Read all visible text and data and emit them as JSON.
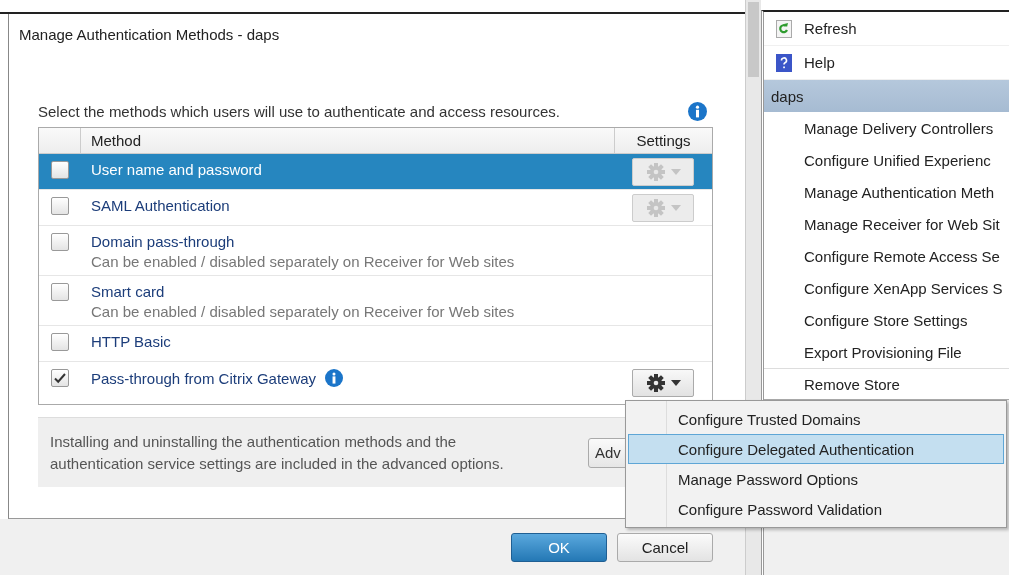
{
  "dialog": {
    "title": "Manage Authentication Methods - daps",
    "instruction": "Select the methods which users will use to authenticate and access resources.",
    "table": {
      "columns": [
        "Method",
        "Settings"
      ],
      "rows": [
        {
          "name": "User name and password",
          "checked": false,
          "selected": true,
          "settings_button": {
            "disabled": true
          }
        },
        {
          "name": "SAML Authentication",
          "checked": false,
          "selected": false,
          "settings_button": {
            "disabled": true
          }
        },
        {
          "name": "Domain pass-through",
          "description": "Can be enabled / disabled separately on Receiver for Web sites",
          "checked": false,
          "selected": false
        },
        {
          "name": "Smart card",
          "description": "Can be enabled / disabled separately on Receiver for Web sites",
          "checked": false,
          "selected": false
        },
        {
          "name": "HTTP Basic",
          "checked": false,
          "selected": false
        },
        {
          "name": "Pass-through from Citrix Gateway",
          "info": true,
          "checked": true,
          "selected": false,
          "settings_button": {
            "disabled": false
          }
        }
      ]
    },
    "advanced_note": "Installing and uninstalling the authentication methods and the authentication service settings are included in the advanced options.",
    "advanced_button": "Adv",
    "buttons": [
      {
        "label": "OK",
        "kind": "primary"
      },
      {
        "label": "Cancel",
        "kind": "secondary"
      }
    ]
  },
  "settings_menu": [
    {
      "label": "Configure Trusted Domains",
      "selected": false
    },
    {
      "label": "Configure Delegated Authentication",
      "selected": true
    },
    {
      "label": "Manage Password Options",
      "selected": false
    },
    {
      "label": "Configure Password Validation",
      "selected": false
    }
  ],
  "actions_pane": {
    "top_items": [
      {
        "label": "Refresh",
        "kind": "refresh"
      },
      {
        "label": "Help",
        "kind": "help"
      }
    ],
    "section": "daps",
    "items": [
      "Manage Delivery Controllers",
      "Configure Unified Experienc",
      "Manage Authentication Meth",
      "Manage Receiver for Web Sit",
      "Configure Remote Access Se",
      "Configure XenApp Services S",
      "Configure Store Settings",
      "Export Provisioning File",
      "Remove Store"
    ]
  }
}
